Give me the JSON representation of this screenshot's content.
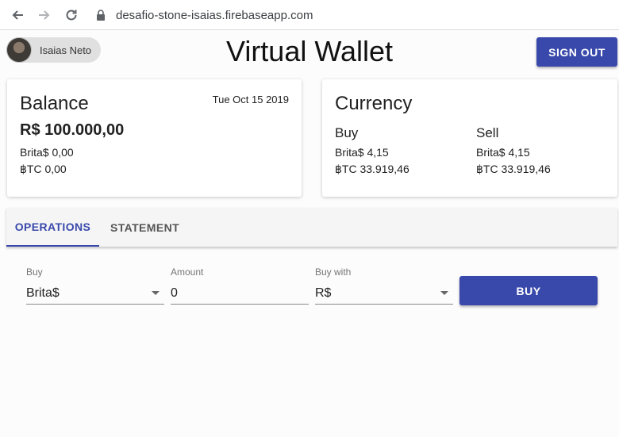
{
  "browser": {
    "url": "desafio-stone-isaias.firebaseapp.com",
    "icons": {
      "back": "arrow-left-icon",
      "forward": "arrow-right-icon",
      "reload": "reload-icon",
      "lock": "lock-icon"
    }
  },
  "header": {
    "user_name": "Isaias Neto",
    "title": "Virtual Wallet",
    "sign_out_label": "SIGN OUT"
  },
  "balance_card": {
    "title": "Balance",
    "date": "Tue Oct 15 2019",
    "amount": "R$ 100.000,00",
    "brita": "Brita$ 0,00",
    "btc": "฿TC 0,00"
  },
  "currency_card": {
    "title": "Currency",
    "buy": {
      "heading": "Buy",
      "brita": "Brita$ 4,15",
      "btc": "฿TC 33.919,46"
    },
    "sell": {
      "heading": "Sell",
      "brita": "Brita$ 4,15",
      "btc": "฿TC 33.919,46"
    }
  },
  "tabs": [
    {
      "label": "OPERATIONS",
      "active": true
    },
    {
      "label": "STATEMENT",
      "active": false
    }
  ],
  "form": {
    "buy": {
      "label": "Buy",
      "value": "Brita$"
    },
    "amount": {
      "label": "Amount",
      "value": "0"
    },
    "buy_with": {
      "label": "Buy with",
      "value": "R$"
    },
    "submit_label": "BUY"
  },
  "colors": {
    "primary": "#3949ab",
    "tab_background": "#f5f5f5"
  }
}
